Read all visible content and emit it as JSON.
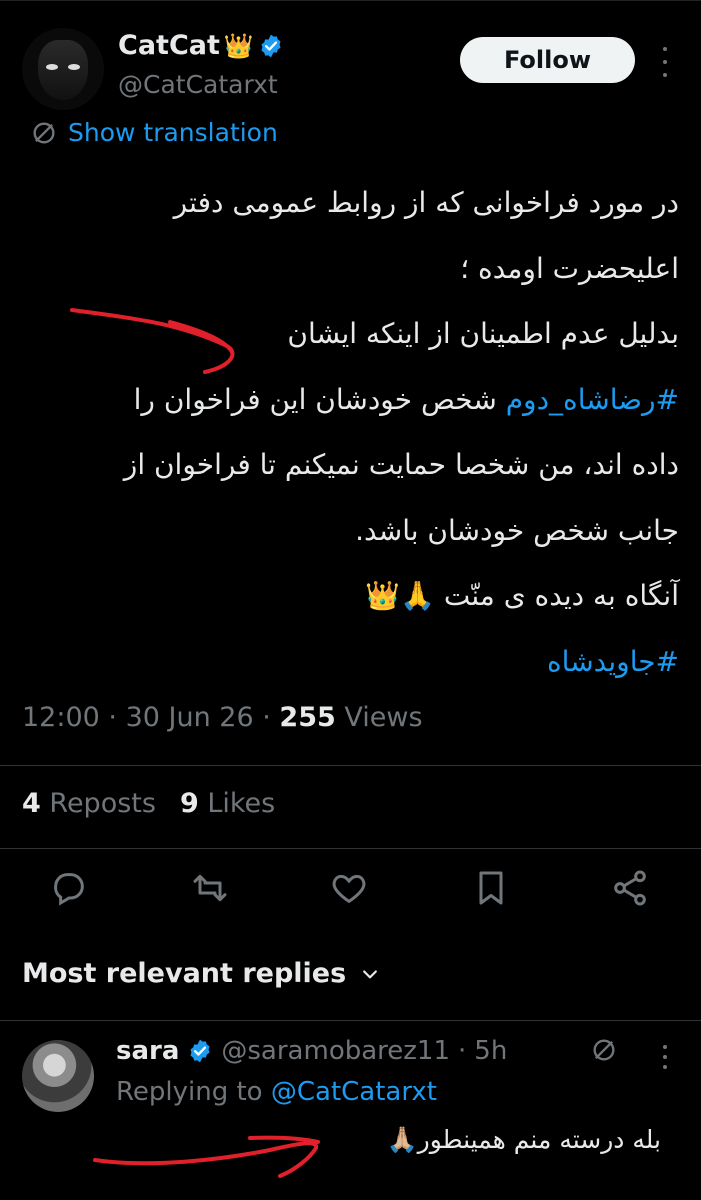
{
  "tweet": {
    "author_name": "CatCat",
    "author_emoji": "👑",
    "author_handle": "@CatCatarxt",
    "follow_label": "Follow",
    "translate_label": "Show translation",
    "lines": [
      "در مورد فراخوانی که از روابط عمومی دفتر",
      "اعلیحضرت اومده ؛",
      "بدلیل عدم اطمینان از اینکه ایشان",
      "",
      "داده اند، من شخصا حمایت نمیکنم تا فراخوان از",
      "جانب شخص خودشان باشد.",
      "آنگاه به دیده ی منّت 🙏👑",
      ""
    ],
    "hashtag_line_tag": "#رضاشاه_دوم",
    "hashtag_line_rest": "شخص خودشان این فراخوان را",
    "final_hashtag": "#جاویدشاه",
    "time": "12:00",
    "date": "30 Jun 26",
    "views_count": "255",
    "views_label": "Views",
    "reposts_count": "4",
    "reposts_label": "Reposts",
    "likes_count": "9",
    "likes_label": "Likes"
  },
  "replies_header": "Most relevant replies",
  "reply": {
    "name": "sara",
    "handle": "@saramobarez11",
    "age": "5h",
    "replying_prefix": "Replying to",
    "replying_handle": "@CatCatarxt",
    "text": "بله درسته منم همینطور🙏🏼"
  },
  "colors": {
    "background": "#000000",
    "text": "#e7e9ea",
    "muted": "#71767b",
    "link": "#1d9bf0",
    "annotation": "#e0202a"
  },
  "icons": [
    "verified-badge-icon",
    "crown-emoji",
    "more-icon",
    "translate-icon",
    "reply-icon",
    "repost-icon",
    "like-icon",
    "bookmark-icon",
    "share-icon",
    "chevron-down-icon",
    "hide-icon"
  ]
}
